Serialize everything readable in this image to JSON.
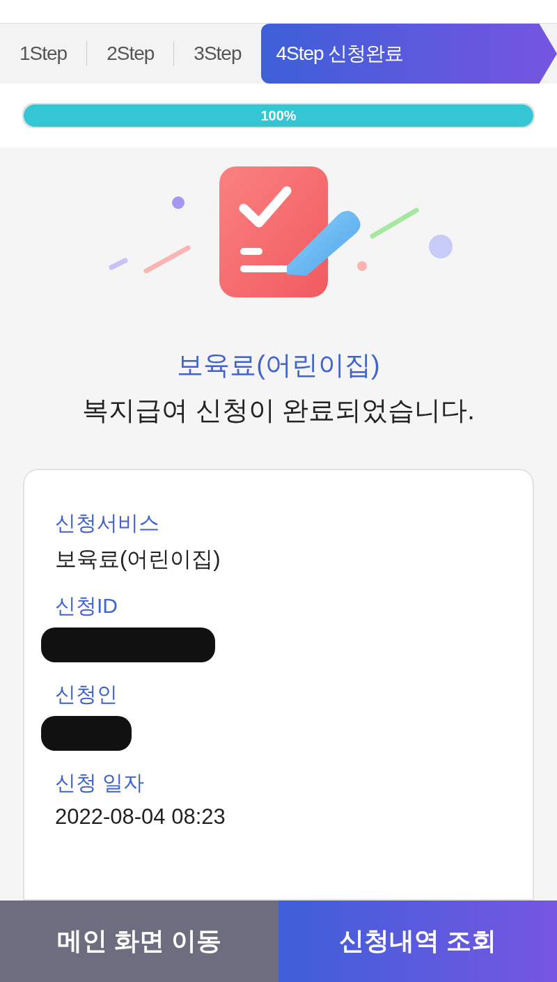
{
  "steps": [
    {
      "label": "1Step",
      "selected": false
    },
    {
      "label": "2Step",
      "selected": false
    },
    {
      "label": "3Step",
      "selected": false
    },
    {
      "label": "4Step 신청완료",
      "selected": true
    }
  ],
  "progress": {
    "level": 1,
    "label": "100%"
  },
  "title": "보육료(어린이집)",
  "message": "복지급여 신청이 완료되었습니다.",
  "details": [
    {
      "label": "신청서비스",
      "value": "보육료(어린이집)",
      "redacted": false
    },
    {
      "label": "신청ID",
      "redacted": true
    },
    {
      "label": "신청인",
      "redacted": true
    },
    {
      "label": "신청 일자",
      "value": "2022-08-04 08:23",
      "redacted": false
    }
  ],
  "buttons": [
    {
      "label": "메인 화면 이동",
      "kind": "secondary"
    },
    {
      "label": "신청내역 조회",
      "kind": "primary"
    }
  ]
}
